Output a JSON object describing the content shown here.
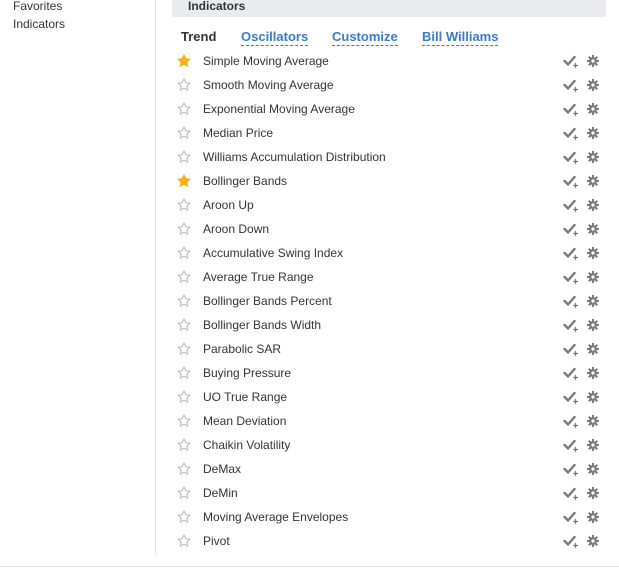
{
  "sidebar": {
    "items": [
      {
        "label": "Favorites"
      },
      {
        "label": "Indicators"
      }
    ]
  },
  "panel": {
    "title": "Indicators"
  },
  "tabs": [
    {
      "label": "Trend",
      "active": true
    },
    {
      "label": "Oscillators",
      "active": false
    },
    {
      "label": "Customize",
      "active": false
    },
    {
      "label": "Bill Williams",
      "active": false
    }
  ],
  "colors": {
    "star_filled": "#f5b21a",
    "star_empty": "#b9b9b9",
    "icon_gray": "#7a7a7a",
    "link_blue": "#3a7bc8",
    "header_bg": "#e9ebee"
  },
  "icons": {
    "favorite": "star-icon",
    "add": "checkmark-plus-icon",
    "settings": "gear-icon"
  },
  "indicators": [
    {
      "name": "Simple Moving Average",
      "favorite": true
    },
    {
      "name": "Smooth Moving Average",
      "favorite": false
    },
    {
      "name": "Exponential Moving Average",
      "favorite": false
    },
    {
      "name": "Median Price",
      "favorite": false
    },
    {
      "name": "Williams Accumulation Distribution",
      "favorite": false
    },
    {
      "name": "Bollinger Bands",
      "favorite": true
    },
    {
      "name": "Aroon Up",
      "favorite": false
    },
    {
      "name": "Aroon Down",
      "favorite": false
    },
    {
      "name": "Accumulative Swing Index",
      "favorite": false
    },
    {
      "name": "Average True Range",
      "favorite": false
    },
    {
      "name": "Bollinger Bands Percent",
      "favorite": false
    },
    {
      "name": "Bollinger Bands Width",
      "favorite": false
    },
    {
      "name": "Parabolic SAR",
      "favorite": false
    },
    {
      "name": "Buying Pressure",
      "favorite": false
    },
    {
      "name": "UO True Range",
      "favorite": false
    },
    {
      "name": "Mean Deviation",
      "favorite": false
    },
    {
      "name": "Chaikin Volatility",
      "favorite": false
    },
    {
      "name": "DeMax",
      "favorite": false
    },
    {
      "name": "DeMin",
      "favorite": false
    },
    {
      "name": "Moving Average Envelopes",
      "favorite": false
    },
    {
      "name": "Pivot",
      "favorite": false
    }
  ]
}
